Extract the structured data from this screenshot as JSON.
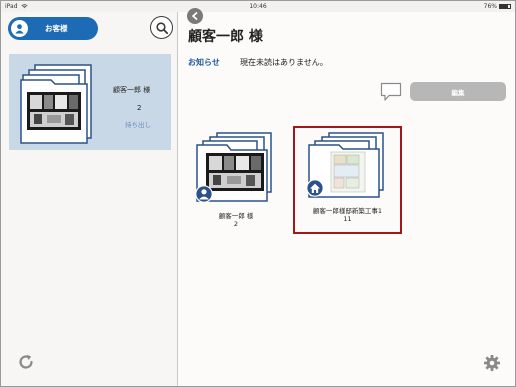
{
  "status_bar": {
    "device": "iPad",
    "time": "10:46",
    "battery": "76%",
    "battery_level": 0.76
  },
  "sidebar": {
    "customer_button_label": "お客様",
    "card": {
      "customer_name": "顧客一郎 様",
      "count": "2",
      "takeout_label": "持ち出し"
    }
  },
  "main": {
    "title": "顧客一郎 様",
    "notice_label": "お知らせ",
    "notice_text": "現在未読はありません。",
    "edit_label": "編集",
    "tiles": [
      {
        "name": "顧客一郎 様",
        "count": "2",
        "icon": "person-icon"
      },
      {
        "name": "顧客一郎様邸新築工事1",
        "count": "11",
        "icon": "house-icon"
      }
    ]
  },
  "colors": {
    "accent": "#1d6ab5",
    "card_bg": "#c9d8e6",
    "selection_border": "#a01818",
    "badge": "#2c5289"
  },
  "icons": [
    "wifi-icon",
    "person-icon",
    "search-icon",
    "back-icon",
    "comment-icon",
    "refresh-icon",
    "gear-icon",
    "house-icon",
    "folder-icon"
  ]
}
